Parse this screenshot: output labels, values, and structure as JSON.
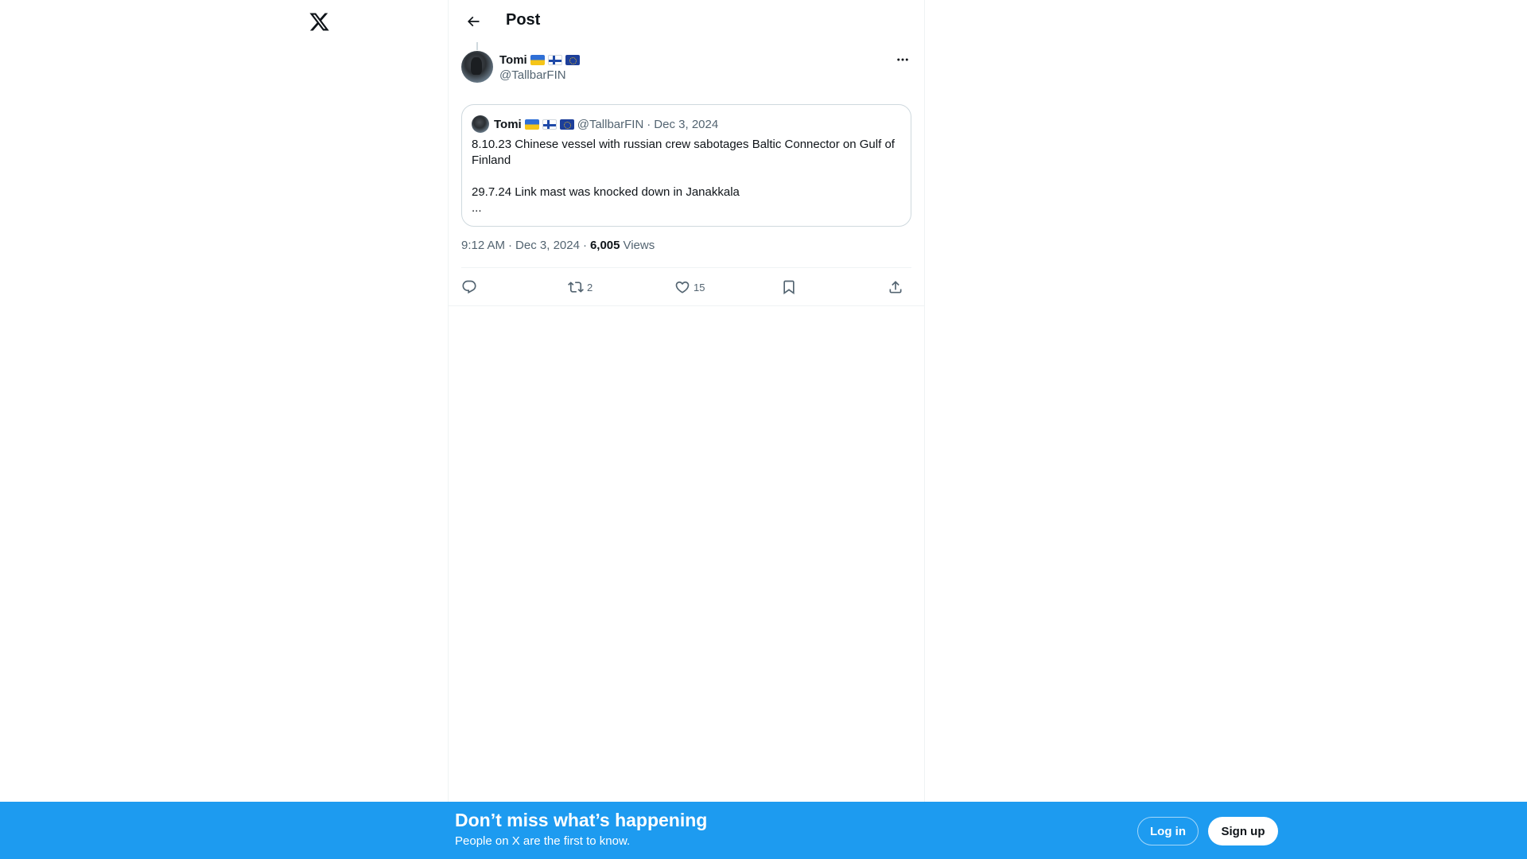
{
  "nav": {
    "logo_icon": "x-logo-icon"
  },
  "header": {
    "title": "Post",
    "back_icon": "arrow-left-icon"
  },
  "post": {
    "author": {
      "name": "Tomi",
      "handle": "@TallbarFIN",
      "flags": [
        "ukraine-flag",
        "finland-flag",
        "eu-flag"
      ]
    },
    "more_icon": "more-dots-icon",
    "quote": {
      "author_name": "Tomi",
      "handle": "@TallbarFIN",
      "separator": "·",
      "date": "Dec 3, 2024",
      "text_line_1": "8.10.23 Chinese vessel with russian crew sabotages Baltic Connector on Gulf of Finland",
      "text_line_2": "29.7.24 Link mast was knocked down in Janakkala",
      "text_line_3": "..."
    },
    "meta": {
      "time": "9:12 AM",
      "sep1": "·",
      "date": "Dec 3, 2024",
      "sep2": "·",
      "views_count": "6,005",
      "views_label": "Views"
    },
    "actions": {
      "reply_count": "",
      "repost_count": "2",
      "like_count": "15"
    }
  },
  "banner": {
    "title": "Don’t miss what’s happening",
    "subtitle": "People on X are the first to know.",
    "login_label": "Log in",
    "signup_label": "Sign up"
  },
  "colors": {
    "accent": "#1d9bf0",
    "text_primary": "#0f1419",
    "text_secondary": "#536471",
    "border": "#cfd9de"
  }
}
